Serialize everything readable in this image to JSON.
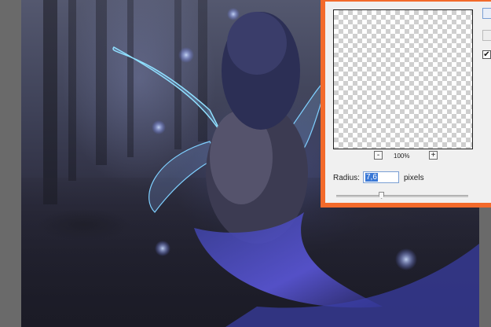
{
  "dialog": {
    "zoom_out_label": "-",
    "zoom_in_label": "+",
    "zoom_level": "100%",
    "radius_label": "Radius:",
    "radius_value": "7,6",
    "pixels_label": "pixels",
    "preview_checked_mark": "✔",
    "slider_level_fraction": 0.34
  },
  "colors": {
    "highlight_border": "#f36a2b",
    "dialog_bg": "#f0f0f0",
    "input_selection": "#3a78d6"
  }
}
